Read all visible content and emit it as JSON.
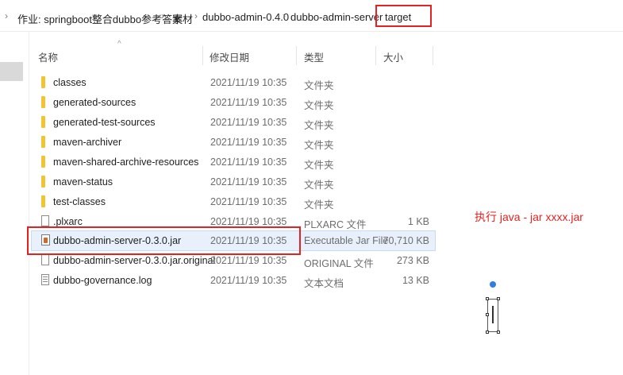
{
  "breadcrumb": {
    "items": [
      "作业: springboot整合dubbo参考答案",
      "素材",
      "dubbo-admin-0.4.0",
      "dubbo-admin-server",
      "target"
    ]
  },
  "columns": {
    "name": "名称",
    "date": "修改日期",
    "type": "类型",
    "size": "大小"
  },
  "files": [
    {
      "name": "classes",
      "date": "2021/11/19 10:35",
      "type": "文件夹",
      "size": "",
      "icon": "folder-icon"
    },
    {
      "name": "generated-sources",
      "date": "2021/11/19 10:35",
      "type": "文件夹",
      "size": "",
      "icon": "folder-icon"
    },
    {
      "name": "generated-test-sources",
      "date": "2021/11/19 10:35",
      "type": "文件夹",
      "size": "",
      "icon": "folder-icon"
    },
    {
      "name": "maven-archiver",
      "date": "2021/11/19 10:35",
      "type": "文件夹",
      "size": "",
      "icon": "folder-icon"
    },
    {
      "name": "maven-shared-archive-resources",
      "date": "2021/11/19 10:35",
      "type": "文件夹",
      "size": "",
      "icon": "folder-icon"
    },
    {
      "name": "maven-status",
      "date": "2021/11/19 10:35",
      "type": "文件夹",
      "size": "",
      "icon": "folder-icon"
    },
    {
      "name": "test-classes",
      "date": "2021/11/19 10:35",
      "type": "文件夹",
      "size": "",
      "icon": "folder-icon"
    },
    {
      "name": ".plxarc",
      "date": "2021/11/19 10:35",
      "type": "PLXARC 文件",
      "size": "1 KB",
      "icon": "file-icon"
    },
    {
      "name": "dubbo-admin-server-0.3.0.jar",
      "date": "2021/11/19 10:35",
      "type": "Executable Jar File",
      "size": "70,710 KB",
      "icon": "jar-icon",
      "selected": true
    },
    {
      "name": "dubbo-admin-server-0.3.0.jar.original",
      "date": "2021/11/19 10:35",
      "type": "ORIGINAL 文件",
      "size": "273 KB",
      "icon": "file-icon"
    },
    {
      "name": "dubbo-governance.log",
      "date": "2021/11/19 10:35",
      "type": "文本文档",
      "size": "13 KB",
      "icon": "log-icon"
    }
  ],
  "annotation": {
    "text": "执行 java - jar  xxxx.jar",
    "color": "#e52222"
  },
  "colors": {
    "highlight_red": "#e52222",
    "folder_yellow": "#f2c430",
    "selection_blue": "#e8f1fb"
  }
}
